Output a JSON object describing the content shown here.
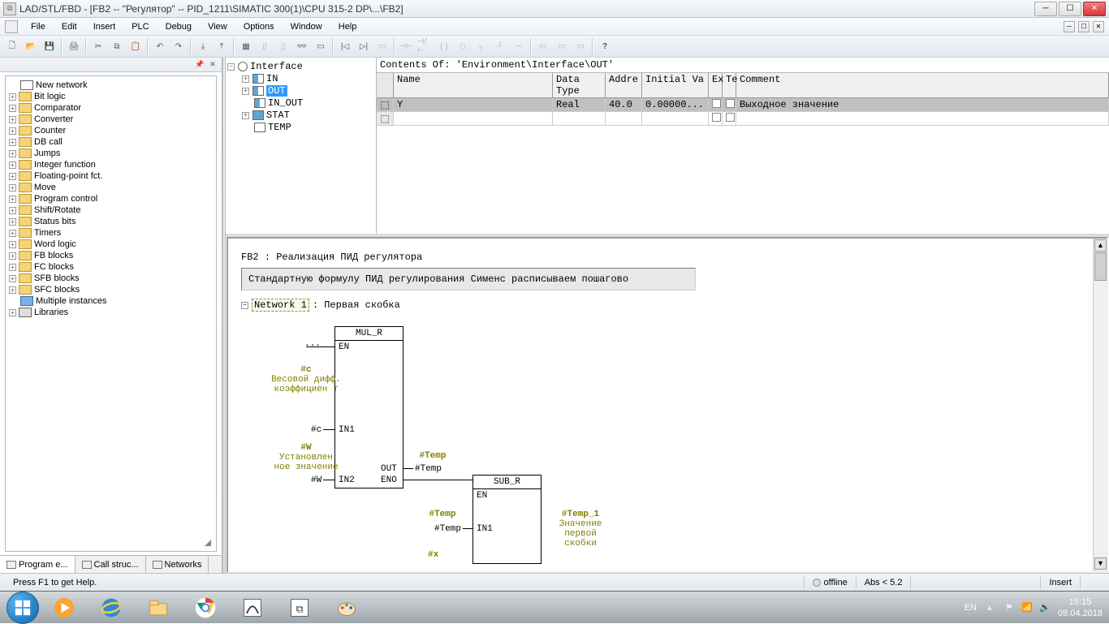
{
  "title": "LAD/STL/FBD  - [FB2 -- \"Регулятор\" -- PID_1211\\SIMATIC 300(1)\\CPU 315-2 DP\\...\\FB2]",
  "menu": [
    "File",
    "Edit",
    "Insert",
    "PLC",
    "Debug",
    "View",
    "Options",
    "Window",
    "Help"
  ],
  "catalog": [
    {
      "exp": "",
      "icon": "nn",
      "label": "New network"
    },
    {
      "exp": "+",
      "icon": "fld",
      "label": "Bit logic"
    },
    {
      "exp": "+",
      "icon": "fld",
      "label": "Comparator"
    },
    {
      "exp": "+",
      "icon": "fld",
      "label": "Converter"
    },
    {
      "exp": "+",
      "icon": "fld",
      "label": "Counter"
    },
    {
      "exp": "+",
      "icon": "fld",
      "label": "DB call"
    },
    {
      "exp": "+",
      "icon": "fld",
      "label": "Jumps"
    },
    {
      "exp": "+",
      "icon": "fld",
      "label": "Integer function"
    },
    {
      "exp": "+",
      "icon": "fld",
      "label": "Floating-point fct."
    },
    {
      "exp": "+",
      "icon": "fld",
      "label": "Move"
    },
    {
      "exp": "+",
      "icon": "fld",
      "label": "Program control"
    },
    {
      "exp": "+",
      "icon": "fld",
      "label": "Shift/Rotate"
    },
    {
      "exp": "+",
      "icon": "fld",
      "label": "Status bits"
    },
    {
      "exp": "+",
      "icon": "fld",
      "label": "Timers"
    },
    {
      "exp": "+",
      "icon": "fld",
      "label": "Word logic"
    },
    {
      "exp": "+",
      "icon": "fld",
      "label": "FB blocks"
    },
    {
      "exp": "+",
      "icon": "fld",
      "label": "FC blocks"
    },
    {
      "exp": "+",
      "icon": "fld",
      "label": "SFB blocks"
    },
    {
      "exp": "+",
      "icon": "fld",
      "label": "SFC blocks"
    },
    {
      "exp": "",
      "icon": "mi",
      "label": "Multiple instances"
    },
    {
      "exp": "+",
      "icon": "lib",
      "label": "Libraries"
    }
  ],
  "sidebarTabs": [
    "Program e...",
    "Call struc...",
    "Networks"
  ],
  "interface": {
    "root": "Interface",
    "items": [
      {
        "exp": "+",
        "icon": "pin",
        "label": "IN"
      },
      {
        "exp": "+",
        "icon": "pin",
        "label": "OUT",
        "selected": true
      },
      {
        "exp": "",
        "icon": "pin",
        "label": "IN_OUT"
      },
      {
        "exp": "+",
        "icon": "stat",
        "label": "STAT"
      },
      {
        "exp": "",
        "icon": "temp",
        "label": "TEMP"
      }
    ]
  },
  "contentsHeader": "Contents Of: 'Environment\\Interface\\OUT'",
  "tableHead": {
    "name": "Name",
    "type": "Data Type",
    "addr": "Addre",
    "init": "Initial Va",
    "ex": "Ex",
    "te": "Te",
    "comment": "Comment"
  },
  "tableRows": [
    {
      "gutter": "⬚",
      "name": "Y",
      "type": "Real",
      "addr": "40.0",
      "init": "0.00000...",
      "ex": "",
      "te": "",
      "comment": "Выходное значение"
    },
    {
      "gutter": "⬚",
      "name": "",
      "type": "",
      "addr": "",
      "init": "",
      "ex": "",
      "te": "",
      "comment": ""
    }
  ],
  "network": {
    "fbTitle": "FB2 : Реализация ПИД регулятора",
    "comment": "Стандартную формулу ПИД регулирования Сименс расписываем пошагово",
    "netLabel": "Network 1",
    "netSuffix": ": Первая скобка",
    "blocks": {
      "mul": {
        "name": "MUL_R",
        "pins": {
          "en": "EN",
          "in1": "IN1",
          "in2": "IN2",
          "eno": "ENO",
          "out": "OUT"
        }
      },
      "sub": {
        "name": "SUB_R",
        "pins": {
          "en": "EN",
          "in1": "IN1"
        }
      }
    },
    "labels": {
      "dots": "...",
      "cVar": "#c",
      "cComment": "Весовой дифф. коэффициен т",
      "cTitle": "#c",
      "wVar": "#W",
      "wComment": "Установлен ное значение",
      "wTitle": "#W",
      "tempVar": "#Temp",
      "tempTitle": "#Temp",
      "tempOut": "#Temp",
      "xVar": "#x",
      "temp1Title": "#Temp_1",
      "temp1Comment": "Значение первой скобки"
    }
  },
  "status": {
    "help": "Press F1 to get Help.",
    "offline": "offline",
    "abs": "Abs < 5.2",
    "insert": "Insert"
  },
  "tray": {
    "lang": "EN",
    "time": "15:15",
    "date": "09.04.2018"
  }
}
